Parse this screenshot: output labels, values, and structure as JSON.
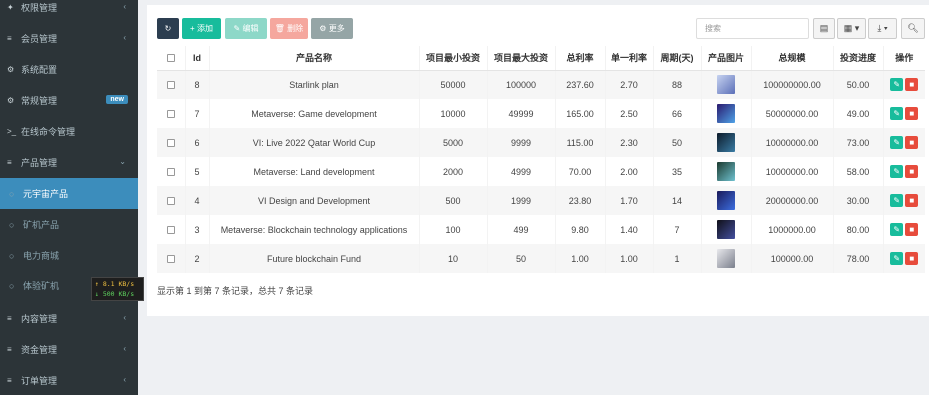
{
  "sidebar": {
    "items": [
      {
        "name": "sidebar-item-permissions",
        "icon": "users-icon",
        "glyph": "✦",
        "label": "权限管理",
        "arrow": "‹"
      },
      {
        "name": "sidebar-item-members",
        "icon": "list-icon",
        "glyph": "≡",
        "label": "会员管理",
        "arrow": "‹"
      },
      {
        "name": "sidebar-item-system-config",
        "icon": "gear-icon",
        "glyph": "⚙",
        "label": "系统配置",
        "arrow": ""
      },
      {
        "name": "sidebar-item-general",
        "icon": "gears-icon",
        "glyph": "⚙",
        "label": "常规管理",
        "badge": "new"
      },
      {
        "name": "sidebar-item-online-commands",
        "icon": "terminal-icon",
        "glyph": ">_",
        "label": "在线命令管理",
        "arrow": ""
      },
      {
        "name": "sidebar-item-products",
        "icon": "list-icon",
        "glyph": "≡",
        "label": "产品管理",
        "arrow": "⌄"
      },
      {
        "name": "sidebar-item-metaverse-products",
        "icon": "circle-icon",
        "glyph": "○",
        "label": "元宇宙产品",
        "active": true
      },
      {
        "name": "sidebar-item-mining-products",
        "icon": "circle-icon",
        "glyph": "○",
        "label": "矿机产品"
      },
      {
        "name": "sidebar-item-power-mall",
        "icon": "circle-icon",
        "glyph": "○",
        "label": "电力商城"
      },
      {
        "name": "sidebar-item-trial-miner",
        "icon": "circle-icon",
        "glyph": "○",
        "label": "体验矿机"
      },
      {
        "name": "sidebar-item-content",
        "icon": "list-icon",
        "glyph": "≡",
        "label": "内容管理",
        "arrow": "‹"
      },
      {
        "name": "sidebar-item-funds",
        "icon": "list-icon",
        "glyph": "≡",
        "label": "资金管理",
        "arrow": "‹"
      },
      {
        "name": "sidebar-item-orders",
        "icon": "list-icon",
        "glyph": "≡",
        "label": "订单管理",
        "arrow": "‹"
      }
    ],
    "netspeed": {
      "up": "↑ 8.1 KB/s",
      "down": "↓ 500 KB/s"
    }
  },
  "toolbar": {
    "refresh_icon": "refresh-icon",
    "add_label": "+ 添加",
    "edit_label": "✎ 编辑",
    "delete_label": "🗑 删除",
    "more_label": "⚙ 更多",
    "search_placeholder": "搜索",
    "toggle_icon": "card-view-icon",
    "columns_icon": "columns-icon",
    "export_icon": "export-icon",
    "search_icon": "search-icon"
  },
  "table": {
    "headers": [
      "",
      "Id",
      "产品名称",
      "项目最小投资",
      "项目最大投资",
      "总利率",
      "单一利率",
      "周期(天)",
      "产品图片",
      "总规模",
      "投资进度",
      "操作"
    ],
    "rows": [
      {
        "id": "8",
        "name": "Starlink plan",
        "min": "50000",
        "max": "100000",
        "total_rate": "237.60",
        "single_rate": "2.70",
        "cycle": "88",
        "image_colors": [
          "#c7d3f0",
          "#5b6fb8"
        ],
        "scale": "100000000.00",
        "progress": "50.00"
      },
      {
        "id": "7",
        "name": "Metaverse: Game development",
        "min": "10000",
        "max": "49999",
        "total_rate": "165.00",
        "single_rate": "2.50",
        "cycle": "66",
        "image_colors": [
          "#2a1a6e",
          "#4fa3e8"
        ],
        "scale": "50000000.00",
        "progress": "49.00"
      },
      {
        "id": "6",
        "name": "VI: Live 2022 Qatar World Cup",
        "min": "5000",
        "max": "9999",
        "total_rate": "115.00",
        "single_rate": "2.30",
        "cycle": "50",
        "image_colors": [
          "#0d1b2a",
          "#3a7ca5"
        ],
        "scale": "10000000.00",
        "progress": "73.00"
      },
      {
        "id": "5",
        "name": "Metaverse: Land development",
        "min": "2000",
        "max": "4999",
        "total_rate": "70.00",
        "single_rate": "2.00",
        "cycle": "35",
        "image_colors": [
          "#1b3a2f",
          "#6fc2d0"
        ],
        "scale": "10000000.00",
        "progress": "58.00"
      },
      {
        "id": "4",
        "name": "VI Design and Development",
        "min": "500",
        "max": "1999",
        "total_rate": "23.80",
        "single_rate": "1.70",
        "cycle": "14",
        "image_colors": [
          "#1a1a5a",
          "#3c6ee0"
        ],
        "scale": "20000000.00",
        "progress": "30.00"
      },
      {
        "id": "3",
        "name": "Metaverse: Blockchain technology applications",
        "min": "100",
        "max": "499",
        "total_rate": "9.80",
        "single_rate": "1.40",
        "cycle": "7",
        "image_colors": [
          "#101018",
          "#4450a0"
        ],
        "scale": "1000000.00",
        "progress": "80.00"
      },
      {
        "id": "2",
        "name": "Future blockchain Fund",
        "min": "10",
        "max": "50",
        "total_rate": "1.00",
        "single_rate": "1.00",
        "cycle": "1",
        "image_colors": [
          "#e8e8ec",
          "#7a7f8c"
        ],
        "scale": "100000.00",
        "progress": "78.00"
      }
    ],
    "row_actions": {
      "edit_icon": "pencil-icon",
      "delete_icon": "trash-icon"
    }
  },
  "footer": {
    "summary": "显示第 1 到第 7 条记录，总共 7 条记录"
  }
}
